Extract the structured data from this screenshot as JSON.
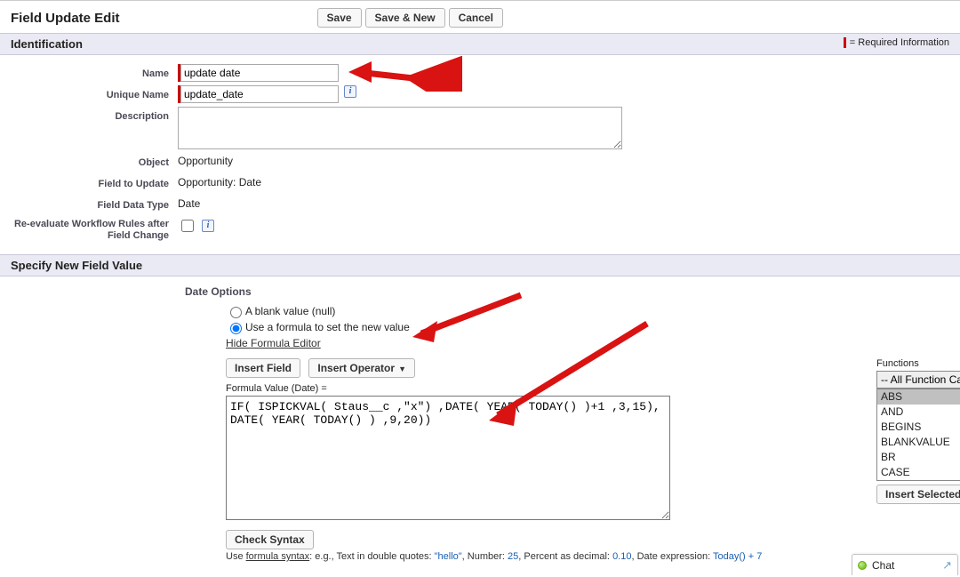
{
  "header": {
    "title": "Field Update Edit",
    "buttons": {
      "save": "Save",
      "save_new": "Save & New",
      "cancel": "Cancel"
    }
  },
  "sections": {
    "identification": "Identification",
    "specify": "Specify New Field Value"
  },
  "required_note": "= Required Information",
  "labels": {
    "name": "Name",
    "unique_name": "Unique Name",
    "description": "Description",
    "object": "Object",
    "field_to_update": "Field to Update",
    "field_data_type": "Field Data Type",
    "reevaluate": "Re-evaluate Workflow Rules after Field Change"
  },
  "values": {
    "name": "update date",
    "unique_name": "update_date",
    "description": "",
    "object": "Opportunity",
    "field_to_update": "Opportunity: Date",
    "field_data_type": "Date",
    "reevaluate_checked": false
  },
  "date_options": {
    "title": "Date Options",
    "blank": "A blank value (null)",
    "formula": "Use a formula to set the new value",
    "selected": "formula",
    "hide_editor": "Hide Formula Editor"
  },
  "formula": {
    "insert_field": "Insert Field",
    "insert_operator": "Insert Operator",
    "value_label": "Formula Value (Date) =",
    "text": "IF( ISPICKVAL( Staus__c ,\"x\") ,DATE( YEAR( TODAY() )+1 ,3,15), \nDATE( YEAR( TODAY() ) ,9,20))",
    "check_syntax": "Check Syntax",
    "hint_prefix": "Use ",
    "hint_syntax": "formula syntax",
    "hint_rest1": ": e.g., Text in double quotes: ",
    "hint_str": "\"hello\"",
    "hint_rest2": ", Number: ",
    "hint_num1": "25",
    "hint_rest3": ", Percent as decimal: ",
    "hint_num2": "0.10",
    "hint_rest4": ", Date expression: ",
    "hint_expr": "Today() + 7"
  },
  "functions": {
    "label": "Functions",
    "category": "-- All Function Categories --",
    "items": [
      "ABS",
      "AND",
      "BEGINS",
      "BLANKVALUE",
      "BR",
      "CASE"
    ],
    "insert_btn": "Insert Selected Function"
  },
  "chat": {
    "label": "Chat"
  }
}
